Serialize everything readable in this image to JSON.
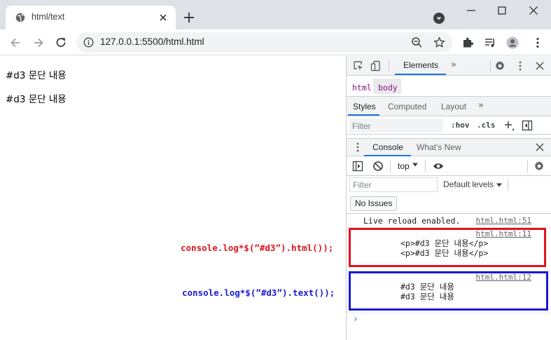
{
  "browser": {
    "tab_title": "html/text",
    "url": "127.0.0.1:5500/html.html",
    "url_host": "127.0.0.1",
    "url_rest": ":5500/html.html"
  },
  "page": {
    "paragraphs": [
      "#d3 문단 내용",
      "#d3 문단 내용"
    ],
    "annotation_html": "console.log*$(”#d3”).html());",
    "annotation_text": "console.log*$(”#d3”).text());"
  },
  "devtools": {
    "main_tab": "Elements",
    "breadcrumbs": [
      "html",
      "body"
    ],
    "style_tabs": [
      "Styles",
      "Computed",
      "Layout"
    ],
    "styles_filter_placeholder": "Filter",
    "hov_label": ":hov",
    "cls_label": ".cls",
    "drawer_tabs": [
      "Console",
      "What's New"
    ],
    "context": "top",
    "console_filter_placeholder": "Filter",
    "levels_label": "Default levels",
    "issues_label": "No Issues",
    "logs": [
      {
        "message": "Live reload enabled.",
        "source": "html.html:51"
      },
      {
        "message": "<p>#d3 문단 내용</p>\n<p>#d3 문단 내용</p>",
        "source": "html.html:11"
      },
      {
        "message": "#d3 문단 내용\n#d3 문단 내용",
        "source": "html.html:12"
      }
    ],
    "prompt": "›"
  },
  "colors": {
    "highlight_red": "#e0141e",
    "highlight_blue": "#1a1ad6",
    "devtools_accent": "#1a73e8",
    "dom_tag": "#881280"
  },
  "icons": [
    "globe-icon",
    "close-icon",
    "plus-icon",
    "tab-search-icon",
    "minimize-icon",
    "maximize-icon",
    "back-icon",
    "forward-icon",
    "reload-icon",
    "info-icon",
    "zoom-icon",
    "star-icon",
    "extensions-icon",
    "media-icon",
    "profile-icon",
    "menu-icon",
    "inspect-icon",
    "device-icon",
    "gear-icon",
    "block-icon",
    "eye-icon",
    "sidebar-icon"
  ]
}
